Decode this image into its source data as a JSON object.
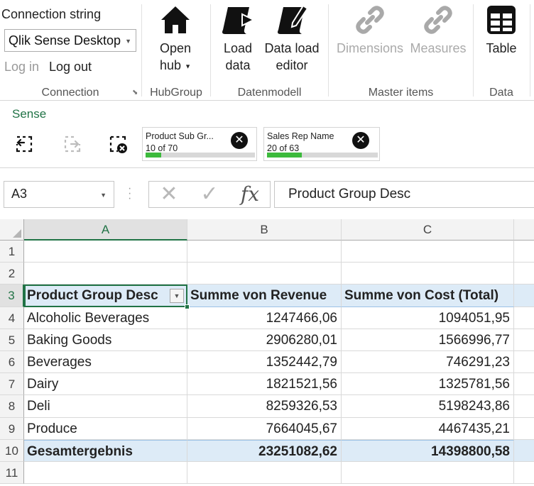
{
  "ribbon": {
    "connection": {
      "string_label": "Connection string",
      "selected": "Qlik Sense Desktop",
      "login": "Log in",
      "logout": "Log out",
      "group_label": "Connection"
    },
    "hubgroup": {
      "open_hub": "Open",
      "open_hub_line2": "hub",
      "group_label": "HubGroup"
    },
    "datenmodell": {
      "load_data": "Load",
      "load_data_line2": "data",
      "data_load_editor": "Data load",
      "data_load_editor_line2": "editor",
      "group_label": "Datenmodell"
    },
    "master_items": {
      "dimensions": "Dimensions",
      "measures": "Measures",
      "group_label": "Master items"
    },
    "data": {
      "table": "Table",
      "group_label": "Data"
    }
  },
  "sense": {
    "title": "Sense",
    "selections": [
      {
        "name": "Product Sub Gr...",
        "count": "10 of 70",
        "fraction": 0.143
      },
      {
        "name": "Sales Rep Name",
        "count": "20 of 63",
        "fraction": 0.317
      }
    ]
  },
  "formula_bar": {
    "name_box": "A3",
    "fx_label": "fx",
    "content": "Product Group Desc"
  },
  "sheet": {
    "columns": [
      "A",
      "B",
      "C"
    ],
    "rows": [
      "1",
      "2",
      "3",
      "4",
      "5",
      "6",
      "7",
      "8",
      "9",
      "10",
      "11"
    ],
    "pivot": {
      "headers": [
        "Product Group Desc",
        "Summe von Revenue",
        "Summe von Cost (Total)"
      ],
      "data": [
        [
          "Alcoholic Beverages",
          "1247466,06",
          "1094051,95"
        ],
        [
          "Baking Goods",
          "2906280,01",
          "1566996,77"
        ],
        [
          "Beverages",
          "1352442,79",
          "746291,23"
        ],
        [
          "Dairy",
          "1821521,56",
          "1325781,56"
        ],
        [
          "Deli",
          "8259326,53",
          "5198243,86"
        ],
        [
          "Produce",
          "7664045,67",
          "4467435,21"
        ]
      ],
      "total": [
        "Gesamtergebnis",
        "23251082,62",
        "14398800,58"
      ]
    }
  },
  "colors": {
    "excel_green": "#217346",
    "pivot_header_bg": "#ddebf7",
    "selection_bar": "#3cba3c"
  }
}
